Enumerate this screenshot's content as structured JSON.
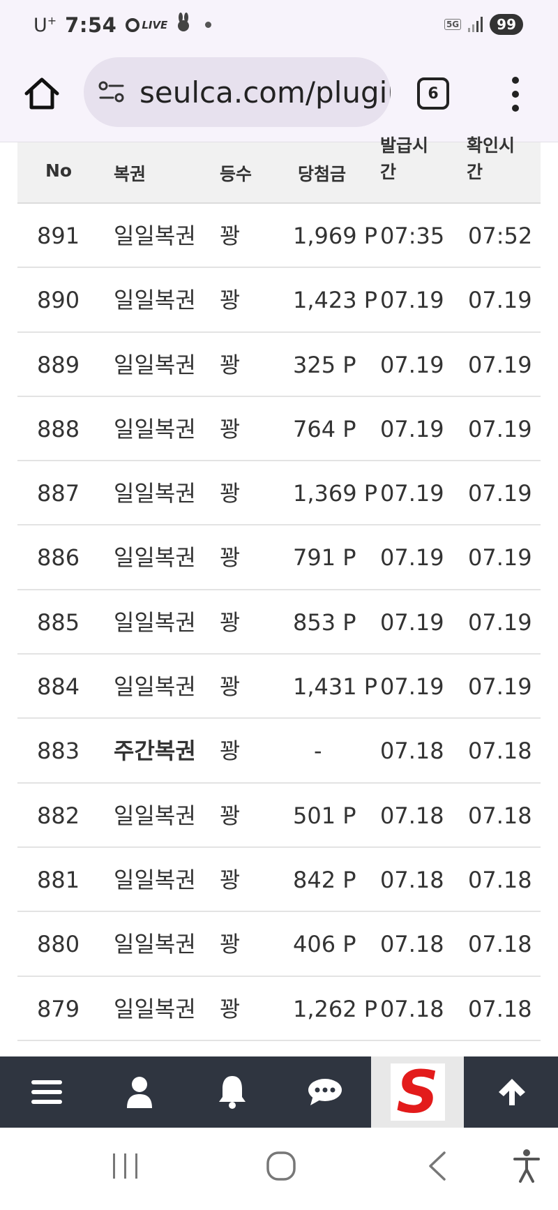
{
  "status_bar": {
    "carrier": "U",
    "carrier_sup": "+",
    "time": "7:54",
    "live": "LIVE",
    "network": "5G",
    "battery": "99"
  },
  "browser": {
    "url": "seulca.com/plugin",
    "tab_count": "6"
  },
  "table": {
    "headers": {
      "no": "No",
      "type": "복권",
      "grade": "등수",
      "prize": "당첨금",
      "issue_time": "발급시간",
      "check_time": "확인시간"
    },
    "rows": [
      {
        "no": "891",
        "type": "일일복권",
        "grade": "꽝",
        "prize": "1,969 P",
        "issue": "07:35",
        "check": "07:52"
      },
      {
        "no": "890",
        "type": "일일복권",
        "grade": "꽝",
        "prize": "1,423 P",
        "issue": "07.19",
        "check": "07.19"
      },
      {
        "no": "889",
        "type": "일일복권",
        "grade": "꽝",
        "prize": "325 P",
        "issue": "07.19",
        "check": "07.19"
      },
      {
        "no": "888",
        "type": "일일복권",
        "grade": "꽝",
        "prize": "764 P",
        "issue": "07.19",
        "check": "07.19"
      },
      {
        "no": "887",
        "type": "일일복권",
        "grade": "꽝",
        "prize": "1,369 P",
        "issue": "07.19",
        "check": "07.19"
      },
      {
        "no": "886",
        "type": "일일복권",
        "grade": "꽝",
        "prize": "791 P",
        "issue": "07.19",
        "check": "07.19"
      },
      {
        "no": "885",
        "type": "일일복권",
        "grade": "꽝",
        "prize": "853 P",
        "issue": "07.19",
        "check": "07.19"
      },
      {
        "no": "884",
        "type": "일일복권",
        "grade": "꽝",
        "prize": "1,431 P",
        "issue": "07.19",
        "check": "07.19"
      },
      {
        "no": "883",
        "type": "주간복권",
        "grade": "꽝",
        "prize": "-",
        "issue": "07.18",
        "check": "07.18"
      },
      {
        "no": "882",
        "type": "일일복권",
        "grade": "꽝",
        "prize": "501 P",
        "issue": "07.18",
        "check": "07.18"
      },
      {
        "no": "881",
        "type": "일일복권",
        "grade": "꽝",
        "prize": "842 P",
        "issue": "07.18",
        "check": "07.18"
      },
      {
        "no": "880",
        "type": "일일복권",
        "grade": "꽝",
        "prize": "406 P",
        "issue": "07.18",
        "check": "07.18"
      },
      {
        "no": "879",
        "type": "일일복권",
        "grade": "꽝",
        "prize": "1,262 P",
        "issue": "07.18",
        "check": "07.18"
      }
    ]
  },
  "bottom_nav": {
    "logo_letter": "S",
    "icons": [
      "menu-icon",
      "user-icon",
      "bell-icon",
      "chat-icon",
      "site-logo",
      "arrow-up-icon"
    ],
    "colors": {
      "background": "#2f3540",
      "logo": "#e31b1b"
    }
  }
}
